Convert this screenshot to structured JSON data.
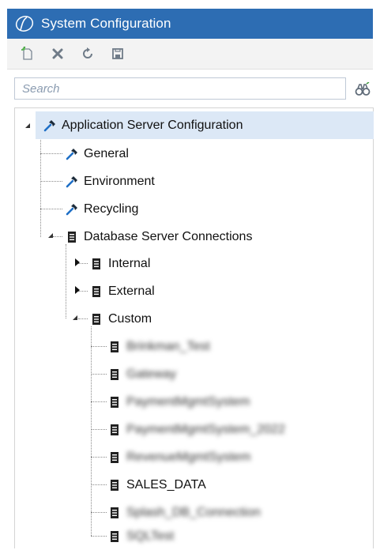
{
  "window": {
    "title": "System Configuration"
  },
  "toolbar": {
    "buttons": [
      {
        "name": "new-button",
        "icon": "new-document-icon"
      },
      {
        "name": "delete-button",
        "icon": "delete-x-icon"
      },
      {
        "name": "refresh-button",
        "icon": "refresh-icon"
      },
      {
        "name": "save-button",
        "icon": "save-disk-icon"
      }
    ]
  },
  "search": {
    "placeholder": "Search",
    "value": ""
  },
  "tree": {
    "root": {
      "label": "Application Server Configuration",
      "expanded": true,
      "selected": true,
      "icon": "hammer-icon"
    },
    "items": {
      "general": {
        "label": "General",
        "icon": "hammer-icon"
      },
      "environment": {
        "label": "Environment",
        "icon": "hammer-icon"
      },
      "recycling": {
        "label": "Recycling",
        "icon": "hammer-icon"
      },
      "db_connections": {
        "label": "Database Server Connections",
        "expanded": true,
        "icon": "database-icon"
      },
      "internal": {
        "label": "Internal",
        "expanded": false,
        "icon": "database-icon"
      },
      "external": {
        "label": "External",
        "expanded": false,
        "icon": "database-icon"
      },
      "custom": {
        "label": "Custom",
        "expanded": true,
        "icon": "database-icon"
      }
    },
    "custom_children": [
      {
        "label": "Brinkman_Test",
        "obscured": true
      },
      {
        "label": "Gateway",
        "obscured": true
      },
      {
        "label": "PaymentMgmtSystem",
        "obscured": true
      },
      {
        "label": "PaymentMgmtSystem_2022",
        "obscured": true
      },
      {
        "label": "RevenueMgmtSystem",
        "obscured": true
      },
      {
        "label": "SALES_DATA",
        "obscured": false
      },
      {
        "label": "Splash_DB_Connection",
        "obscured": true
      },
      {
        "label": "SQLTest",
        "obscured": true
      }
    ]
  },
  "colors": {
    "titlebar": "#2d6db3",
    "selection": "#dce8f6",
    "toolbar_bg": "#f3f3f3",
    "search_border": "#bfc9d6"
  }
}
